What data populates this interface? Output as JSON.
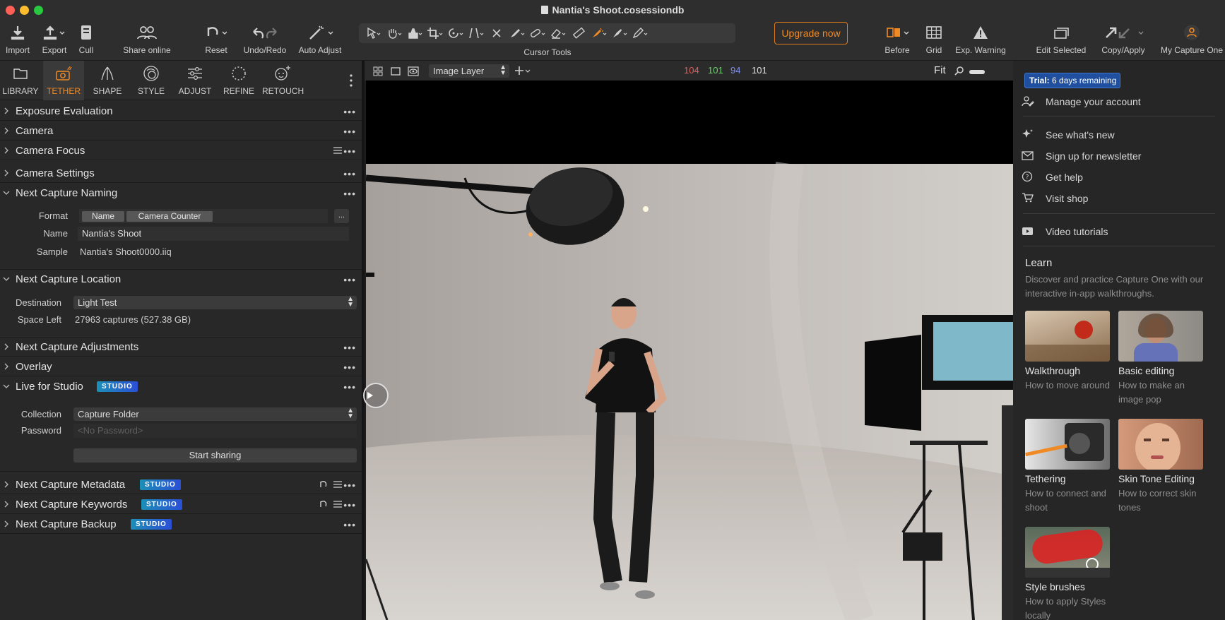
{
  "window": {
    "title": "Nantia's Shoot.cosessiondb"
  },
  "toolbar": {
    "import": "Import",
    "export": "Export",
    "cull": "Cull",
    "share_online": "Share online",
    "reset": "Reset",
    "undo_redo": "Undo/Redo",
    "auto_adjust": "Auto Adjust",
    "cursor_tools": "Cursor Tools",
    "upgrade": "Upgrade now",
    "before": "Before",
    "grid": "Grid",
    "exp_warning": "Exp. Warning",
    "edit_selected": "Edit Selected",
    "copy_apply": "Copy/Apply",
    "my_capture_one": "My Capture One"
  },
  "tool_tabs": {
    "library": "LIBRARY",
    "tether": "TETHER",
    "shape": "SHAPE",
    "style": "STYLE",
    "adjust": "ADJUST",
    "refine": "REFINE",
    "retouch": "RETOUCH"
  },
  "sections": {
    "exposure_evaluation": "Exposure Evaluation",
    "camera": "Camera",
    "camera_focus": "Camera Focus",
    "camera_settings": "Camera Settings",
    "next_capture_naming": "Next Capture Naming",
    "next_capture_location": "Next Capture Location",
    "next_capture_adjustments": "Next Capture Adjustments",
    "overlay": "Overlay",
    "live_for_studio": "Live for Studio",
    "next_capture_metadata": "Next Capture Metadata",
    "next_capture_keywords": "Next Capture Keywords",
    "next_capture_backup": "Next Capture Backup",
    "studio_badge": "STUDIO",
    "more": "•••"
  },
  "naming": {
    "format_label": "Format",
    "format_tokens": [
      "Name",
      "Camera Counter"
    ],
    "format_more": "...",
    "name_label": "Name",
    "name_value": "Nantia's Shoot",
    "sample_label": "Sample",
    "sample_value": "Nantia's Shoot0000.iiq"
  },
  "location": {
    "destination_label": "Destination",
    "destination_value": "Light Test",
    "space_left_label": "Space Left",
    "space_left_value": "27963 captures (527.38 GB)"
  },
  "live": {
    "collection_label": "Collection",
    "collection_value": "Capture Folder",
    "password_label": "Password",
    "password_placeholder": "<No Password>",
    "start_sharing": "Start sharing"
  },
  "viewer": {
    "layer_select": "Image Layer",
    "rgb": {
      "r": "104",
      "g": "101",
      "b": "94",
      "l": "101"
    },
    "fit": "Fit"
  },
  "account_menu": {
    "trial": {
      "bold": "Trial:",
      "rest": " 6 days remaining"
    },
    "manage": "Manage your account",
    "whats_new": "See what's new",
    "newsletter": "Sign up for newsletter",
    "help": "Get help",
    "shop": "Visit shop",
    "tutorials": "Video tutorials",
    "learn_title": "Learn",
    "learn_desc": "Discover and practice Capture One with our interactive in-app walkthroughs.",
    "cards": [
      {
        "title": "Walkthrough",
        "sub": "How to move around"
      },
      {
        "title": "Basic editing",
        "sub": "How to make an image pop"
      },
      {
        "title": "Tethering",
        "sub": "How to connect and shoot"
      },
      {
        "title": "Skin Tone Editing",
        "sub": "How to correct skin tones"
      },
      {
        "title": "Style brushes",
        "sub": "How to apply Styles locally"
      }
    ]
  },
  "colors": {
    "accent": "#f08a24",
    "studio_from": "#1d8fb8",
    "studio_to": "#2b4fd6",
    "trial_bg": "#1f4f9e",
    "rgb_r": "#e06060",
    "rgb_g": "#72d072",
    "rgb_b": "#7c8cf0"
  }
}
